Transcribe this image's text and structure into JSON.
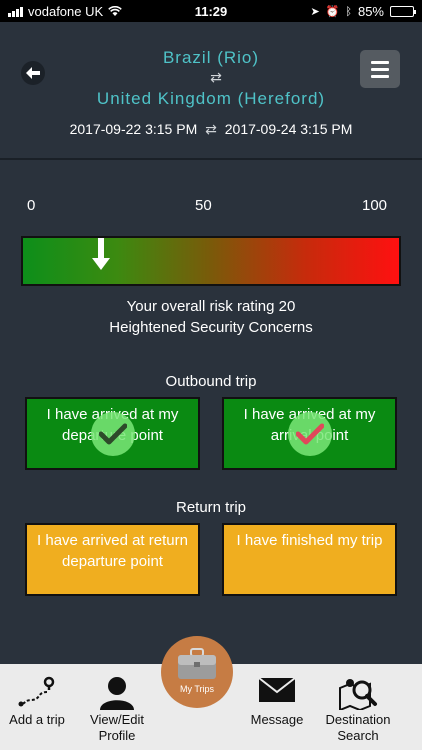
{
  "status_bar": {
    "carrier": "vodafone UK",
    "time": "11:29",
    "battery": "85%",
    "battery_level": 0.85
  },
  "header": {
    "origin": "Brazil (Rio)",
    "destination": "United Kingdom (Hereford)",
    "depart_datetime": "2017-09-22 3:15 PM",
    "return_datetime": "2017-09-24 3:15 PM"
  },
  "risk": {
    "scale_min": "0",
    "scale_mid": "50",
    "scale_max": "100",
    "value": 20,
    "rating_text": "Your overall risk rating 20",
    "level_text": "Heightened Security Concerns",
    "colors": {
      "low": "#0d8f1a",
      "high": "#ff1010"
    }
  },
  "outbound": {
    "title": "Outbound trip",
    "buttons": [
      {
        "label": "I have arrived at my departure point",
        "status": "done",
        "check_color": "#2e4a2a"
      },
      {
        "label": "I have arrived at my arrival point",
        "status": "done",
        "check_color": "#e0485a"
      }
    ]
  },
  "return_trip": {
    "title": "Return trip",
    "buttons": [
      {
        "label": "I have arrived at return departure point"
      },
      {
        "label": "I have finished my trip"
      }
    ]
  },
  "nav": {
    "add_trip": "Add a trip",
    "view_edit_profile": "View/Edit Profile",
    "my_trips": "My Trips",
    "message": "Message",
    "destination_search": "Destination Search"
  },
  "colors": {
    "background": "#2a323c",
    "accent_teal": "#4fc3c8",
    "green_button": "#0a8a12",
    "amber_button": "#f0ae1f",
    "my_trips": "#c67c44"
  }
}
